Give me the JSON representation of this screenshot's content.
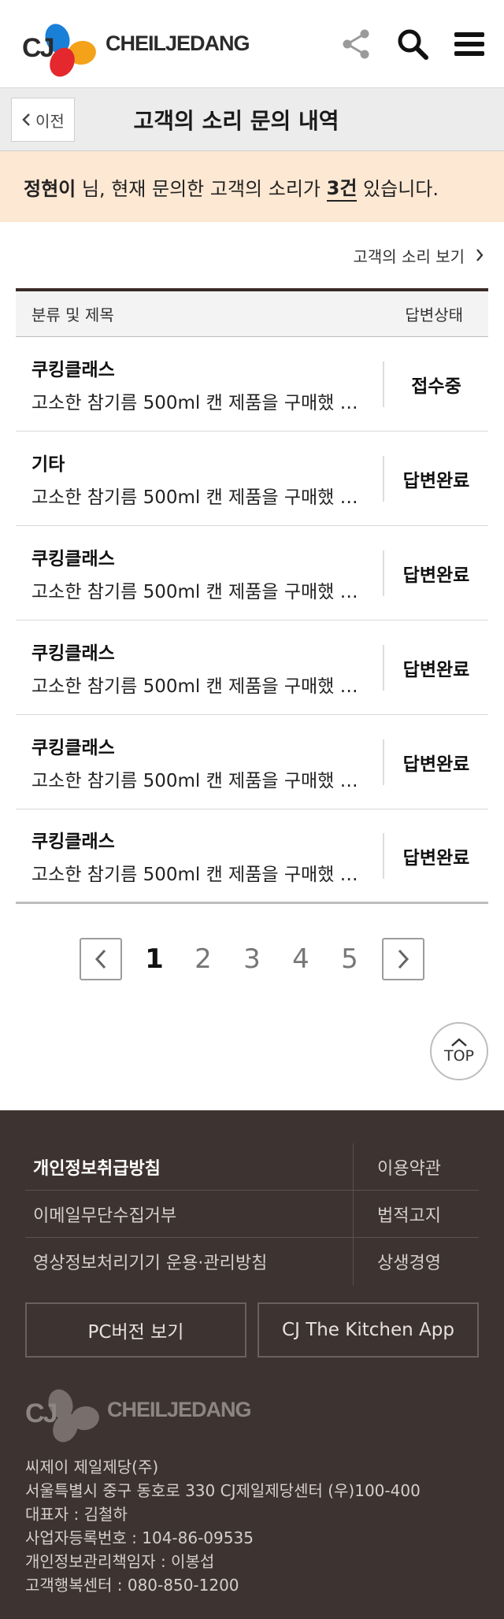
{
  "header": {
    "logo_cj": "CJ",
    "brand_name": "CHEILJEDANG",
    "icons": [
      "share-icon",
      "search-icon",
      "menu-icon"
    ]
  },
  "titlebar": {
    "back_label": "이전",
    "title": "고객의 소리 문의 내역"
  },
  "notice": {
    "user_name": "정현이",
    "text_before": " 님, 현재 문의한 고객의 소리가 ",
    "count": "3건",
    "text_after": " 있습니다."
  },
  "list": {
    "view_link": "고객의 소리 보기",
    "col_title": "분류 및 제목",
    "col_status": "답변상태",
    "rows": [
      {
        "category": "쿠킹클래스",
        "title": "고소한 참기름 500ml 캔 제품을 구매했 …",
        "status": "접수중"
      },
      {
        "category": "기타",
        "title": "고소한 참기름 500ml 캔 제품을 구매했 …",
        "status": "답변완료"
      },
      {
        "category": "쿠킹클래스",
        "title": "고소한 참기름 500ml 캔 제품을 구매했 …",
        "status": "답변완료"
      },
      {
        "category": "쿠킹클래스",
        "title": "고소한 참기름 500ml 캔 제품을 구매했 …",
        "status": "답변완료"
      },
      {
        "category": "쿠킹클래스",
        "title": "고소한 참기름 500ml 캔 제품을 구매했 …",
        "status": "답변완료"
      },
      {
        "category": "쿠킹클래스",
        "title": "고소한 참기름 500ml 캔 제품을 구매했 …",
        "status": "답변완료"
      }
    ]
  },
  "pagination": {
    "pages": [
      "1",
      "2",
      "3",
      "4",
      "5"
    ],
    "current": "1"
  },
  "top_button": "TOP",
  "footer": {
    "links": {
      "privacy": "개인정보취급방침",
      "terms": "이용약관",
      "email_refusal": "이메일무단수집거부",
      "legal": "법적고지",
      "cctv_policy": "영상정보처리기기 운용·관리방침",
      "win_win": "상생경영"
    },
    "pc_version": "PC버전 보기",
    "app_button": "CJ The Kitchen App",
    "logo_cj": "CJ",
    "brand_name": "CHEILJEDANG",
    "info": {
      "company": "씨제이 제일제당(주)",
      "address": "서울특별시 중구 동호로 330 CJ제일제당센터 (우)100-400",
      "ceo": "대표자 : 김철하",
      "biz_no": "사업자등록번호 : 104-86-09535",
      "privacy_officer": "개인정보관리책임자 : 이봉섭",
      "cs_center": "고객행복센터 : 080-850-1200"
    }
  },
  "colors": {
    "notice_bg": "#fde8d3",
    "footer_bg": "#3d3330",
    "table_top_border": "#3a2b26",
    "logo_blue": "#1a7fd6",
    "logo_red": "#e4282e",
    "logo_orange": "#f5a21b"
  }
}
